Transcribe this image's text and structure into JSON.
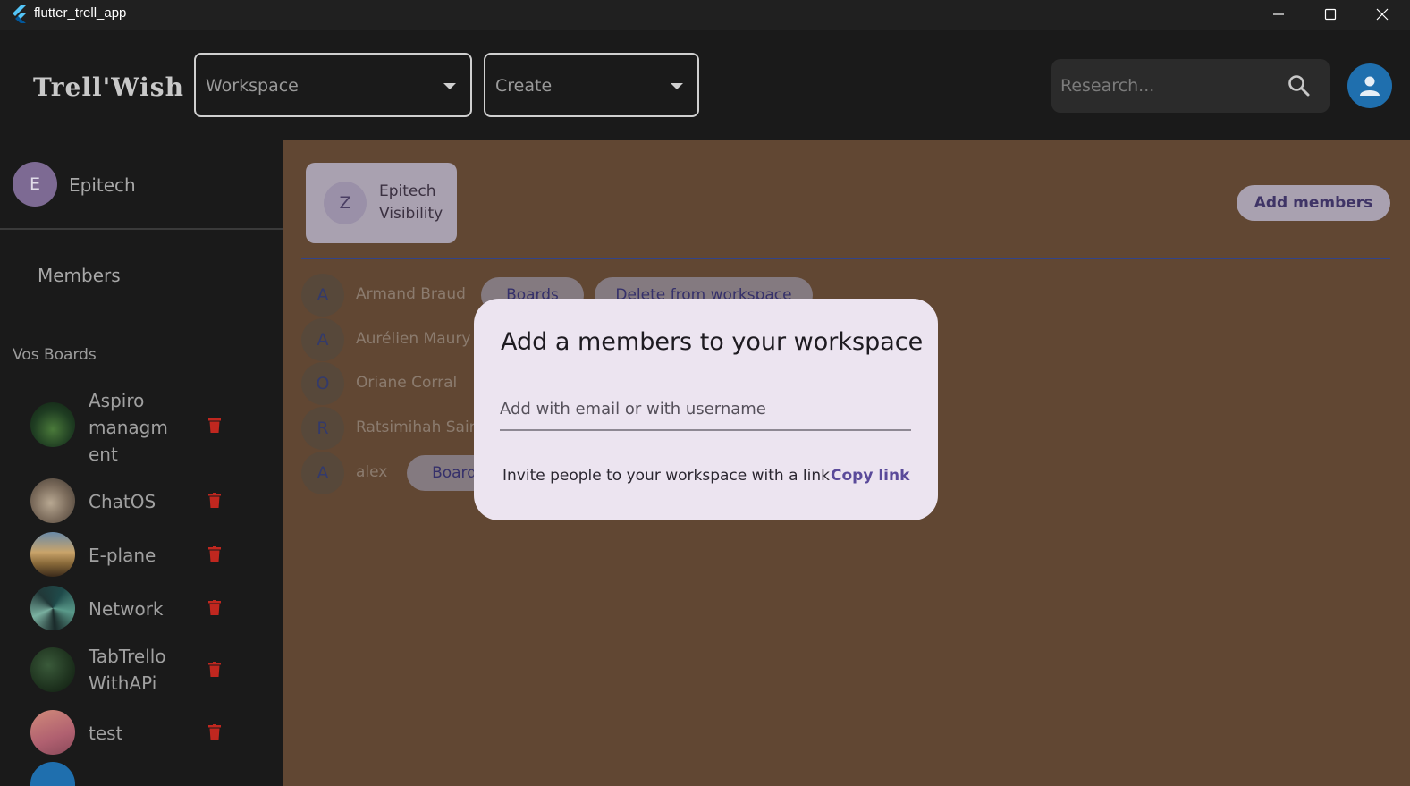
{
  "window": {
    "title": "flutter_trell_app"
  },
  "appbar": {
    "brand": "Trell'Wish",
    "workspace_dropdown": "Workspace",
    "create_dropdown": "Create",
    "search_placeholder": "Research..."
  },
  "sidebar": {
    "workspace": {
      "initial": "E",
      "name": "Epitech"
    },
    "members_label": "Members",
    "boards_heading": "Vos Boards",
    "boards": [
      {
        "name": "Aspiro managm ent"
      },
      {
        "name": "ChatOS"
      },
      {
        "name": "E-plane"
      },
      {
        "name": "Network"
      },
      {
        "name": "TabTrello WithAPi"
      },
      {
        "name": "test"
      }
    ]
  },
  "main": {
    "workspace_card": {
      "initial": "Z",
      "title": "Epitech",
      "subtitle": "Visibility"
    },
    "add_members_label": "Add members",
    "members": [
      {
        "initial": "A",
        "name": "Armand Braud",
        "boards_label": "Boards",
        "delete_label": "Delete from workspace"
      },
      {
        "initial": "A",
        "name": "Aurélien Maury"
      },
      {
        "initial": "O",
        "name": "Oriane Corral"
      },
      {
        "initial": "R",
        "name": "Ratsimihah Saina"
      },
      {
        "initial": "A",
        "name": "alex",
        "boards_label": "Boards"
      }
    ]
  },
  "dialog": {
    "title": "Add a members to your workspace",
    "input_placeholder": "Add with email or with username",
    "invite_text": "Invite people to your workspace with a link",
    "copy_link_label": "Copy link"
  },
  "colors": {
    "main_background": "#614733",
    "sidebar_background": "#1a1a1a",
    "dialog_background": "#ece4f0",
    "accent_divider": "#33448a",
    "avatar_blue": "#1f6fae",
    "delete_red": "#c0271f"
  }
}
